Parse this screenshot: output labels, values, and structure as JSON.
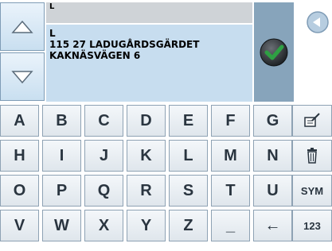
{
  "input": {
    "field_text": "L",
    "result_lines": [
      "L",
      "115 27 LADUGÅRDSGÄRDET",
      "KAKNÄSVÄGEN 6"
    ]
  },
  "keyboard": {
    "rows": [
      [
        "A",
        "B",
        "C",
        "D",
        "E",
        "F",
        "G"
      ],
      [
        "H",
        "I",
        "J",
        "K",
        "L",
        "M",
        "N"
      ],
      [
        "O",
        "P",
        "Q",
        "R",
        "S",
        "T",
        "U"
      ],
      [
        "V",
        "W",
        "X",
        "Y",
        "Z",
        "_",
        "←"
      ]
    ],
    "side_keys": {
      "sym_label": "SYM",
      "num_label": "123"
    }
  },
  "icons": {
    "scroll_up": "triangle-up-icon",
    "scroll_down": "triangle-down-icon",
    "confirm": "checkmark-icon",
    "back": "arrow-left-circle-icon",
    "edit": "edit-note-icon",
    "delete": "trash-icon"
  },
  "colors": {
    "result_bg": "#c7ddef",
    "confirm_bg": "#87a4bb",
    "confirm_green": "#2ea043"
  }
}
